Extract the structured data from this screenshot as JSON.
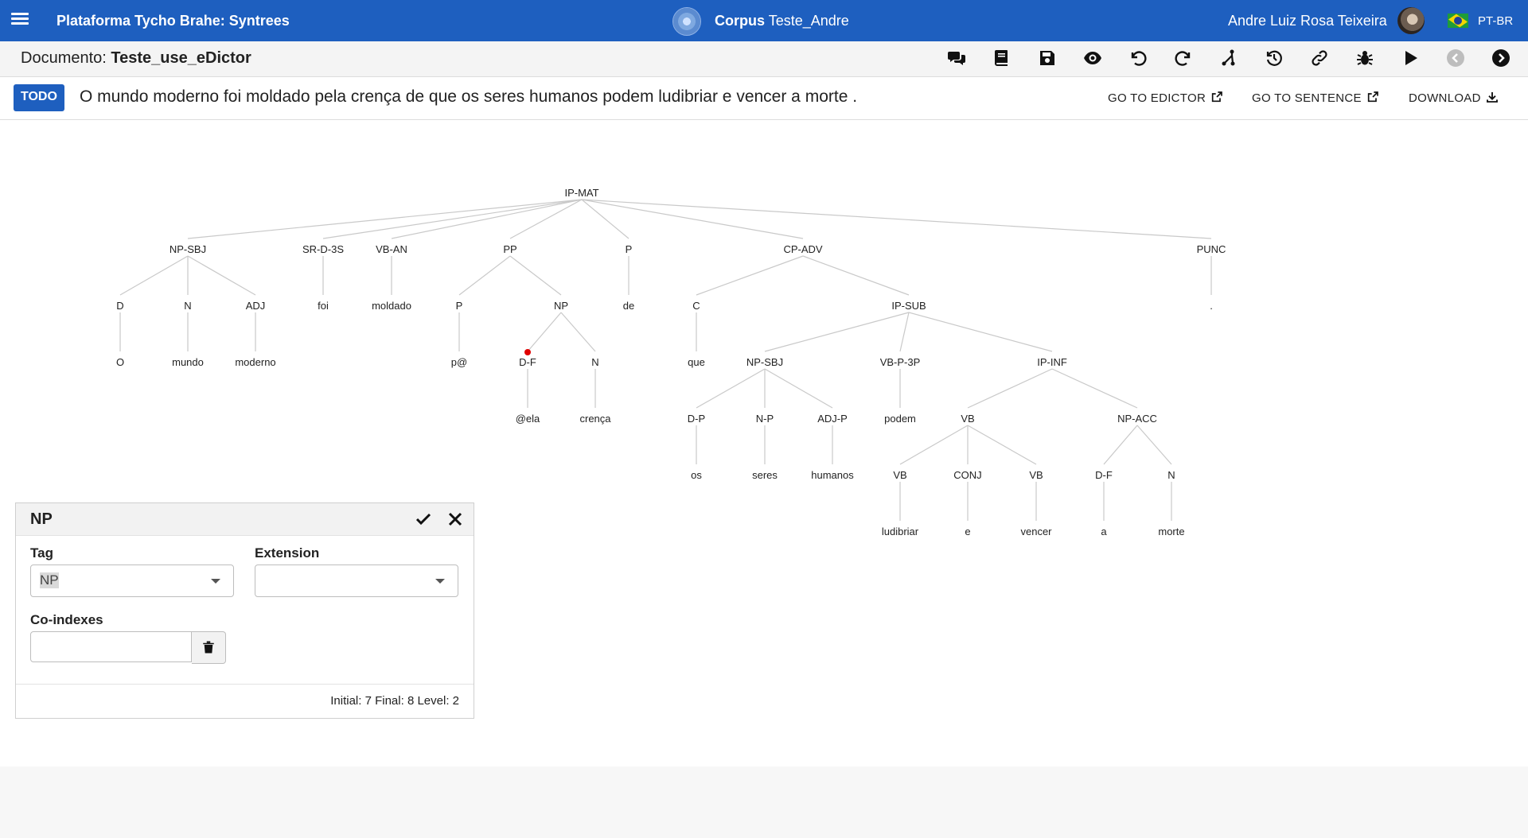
{
  "header": {
    "app_title": "Plataforma Tycho Brahe: Syntrees",
    "corpus_label": "Corpus",
    "corpus_name": "Teste_Andre",
    "user_name": "Andre Luiz Rosa Teixeira",
    "language": "PT-BR",
    "brand_color": "#1e5fbf"
  },
  "document": {
    "label": "Documento:",
    "name": "Teste_use_eDictor",
    "toolbar_icons": [
      "comments-icon",
      "book-icon",
      "save-icon",
      "eye-icon",
      "undo-icon",
      "redo-icon",
      "tree-branch-icon",
      "history-icon",
      "link-icon",
      "bug-icon",
      "play-icon",
      "previous-icon",
      "next-icon"
    ]
  },
  "sentence": {
    "status": "TODO",
    "text": "O mundo moderno foi moldado pela crença de que os seres humanos podem ludibriar e vencer a morte .",
    "go_to_edictor": "GO TO EDICTOR",
    "go_to_sentence": "GO TO SENTENCE",
    "download": "DOWNLOAD"
  },
  "tree": {
    "nodes": [
      {
        "id": "ipmat",
        "label": "IP-MAT"
      },
      {
        "id": "npsbj",
        "label": "NP-SBJ"
      },
      {
        "id": "srd3s",
        "label": "SR-D-3S"
      },
      {
        "id": "vban",
        "label": "VB-AN"
      },
      {
        "id": "pp",
        "label": "PP"
      },
      {
        "id": "p1",
        "label": "P"
      },
      {
        "id": "cpadv",
        "label": "CP-ADV"
      },
      {
        "id": "punc",
        "label": "PUNC"
      },
      {
        "id": "d1",
        "label": "D"
      },
      {
        "id": "n1",
        "label": "N"
      },
      {
        "id": "adj1",
        "label": "ADJ"
      },
      {
        "id": "foi",
        "label": "foi"
      },
      {
        "id": "moldado",
        "label": "moldado"
      },
      {
        "id": "p2",
        "label": "P"
      },
      {
        "id": "np1",
        "label": "NP"
      },
      {
        "id": "de",
        "label": "de"
      },
      {
        "id": "c1",
        "label": "C"
      },
      {
        "id": "ipsub",
        "label": "IP-SUB"
      },
      {
        "id": "period",
        "label": "."
      },
      {
        "id": "o",
        "label": "O"
      },
      {
        "id": "mundo",
        "label": "mundo"
      },
      {
        "id": "moderno",
        "label": "moderno"
      },
      {
        "id": "pat",
        "label": "p@"
      },
      {
        "id": "df1",
        "label": "D-F"
      },
      {
        "id": "n2",
        "label": "N"
      },
      {
        "id": "que",
        "label": "que"
      },
      {
        "id": "npsbj2",
        "label": "NP-SBJ"
      },
      {
        "id": "vbp3p",
        "label": "VB-P-3P"
      },
      {
        "id": "ipinf",
        "label": "IP-INF"
      },
      {
        "id": "ela",
        "label": "@ela"
      },
      {
        "id": "crenca",
        "label": "crença"
      },
      {
        "id": "dp",
        "label": "D-P"
      },
      {
        "id": "np2",
        "label": "N-P"
      },
      {
        "id": "adjp",
        "label": "ADJ-P"
      },
      {
        "id": "podem",
        "label": "podem"
      },
      {
        "id": "vb1",
        "label": "VB"
      },
      {
        "id": "npacc",
        "label": "NP-ACC"
      },
      {
        "id": "os",
        "label": "os"
      },
      {
        "id": "seres",
        "label": "seres"
      },
      {
        "id": "humanos",
        "label": "humanos"
      },
      {
        "id": "vb2",
        "label": "VB"
      },
      {
        "id": "conj",
        "label": "CONJ"
      },
      {
        "id": "vb3",
        "label": "VB"
      },
      {
        "id": "df2",
        "label": "D-F"
      },
      {
        "id": "n3",
        "label": "N"
      },
      {
        "id": "ludibriar",
        "label": "ludibriar"
      },
      {
        "id": "e",
        "label": "e"
      },
      {
        "id": "vencer",
        "label": "vencer"
      },
      {
        "id": "a",
        "label": "a"
      },
      {
        "id": "morte",
        "label": "morte"
      }
    ],
    "edges": [
      [
        "ipmat",
        "npsbj"
      ],
      [
        "ipmat",
        "srd3s"
      ],
      [
        "ipmat",
        "vban"
      ],
      [
        "ipmat",
        "pp"
      ],
      [
        "ipmat",
        "p1"
      ],
      [
        "ipmat",
        "cpadv"
      ],
      [
        "ipmat",
        "punc"
      ],
      [
        "npsbj",
        "d1"
      ],
      [
        "npsbj",
        "n1"
      ],
      [
        "npsbj",
        "adj1"
      ],
      [
        "srd3s",
        "foi"
      ],
      [
        "vban",
        "moldado"
      ],
      [
        "pp",
        "p2"
      ],
      [
        "pp",
        "np1"
      ],
      [
        "p1",
        "de"
      ],
      [
        "cpadv",
        "c1"
      ],
      [
        "cpadv",
        "ipsub"
      ],
      [
        "punc",
        "period"
      ],
      [
        "d1",
        "o"
      ],
      [
        "n1",
        "mundo"
      ],
      [
        "adj1",
        "moderno"
      ],
      [
        "p2",
        "pat"
      ],
      [
        "np1",
        "df1"
      ],
      [
        "np1",
        "n2"
      ],
      [
        "c1",
        "que"
      ],
      [
        "ipsub",
        "npsbj2"
      ],
      [
        "ipsub",
        "vbp3p"
      ],
      [
        "ipsub",
        "ipinf"
      ],
      [
        "df1",
        "ela"
      ],
      [
        "n2",
        "crenca"
      ],
      [
        "npsbj2",
        "dp"
      ],
      [
        "npsbj2",
        "np2"
      ],
      [
        "npsbj2",
        "adjp"
      ],
      [
        "vbp3p",
        "podem"
      ],
      [
        "ipinf",
        "vb1"
      ],
      [
        "ipinf",
        "npacc"
      ],
      [
        "dp",
        "os"
      ],
      [
        "np2",
        "seres"
      ],
      [
        "adjp",
        "humanos"
      ],
      [
        "vb1",
        "vb2"
      ],
      [
        "vb1",
        "conj"
      ],
      [
        "vb1",
        "vb3"
      ],
      [
        "npacc",
        "df2"
      ],
      [
        "npacc",
        "n3"
      ],
      [
        "vb2",
        "ludibriar"
      ],
      [
        "conj",
        "e"
      ],
      [
        "vb3",
        "vencer"
      ],
      [
        "df2",
        "a"
      ],
      [
        "n3",
        "morte"
      ]
    ],
    "marked_node": "df1",
    "marker_color": "#e00000"
  },
  "editor": {
    "title": "NP",
    "tag_label": "Tag",
    "tag_value": "NP",
    "extension_label": "Extension",
    "extension_value": "",
    "coindexes_label": "Co-indexes",
    "coindexes_value": "",
    "footer": "Initial: 7 Final: 8 Level: 2"
  }
}
